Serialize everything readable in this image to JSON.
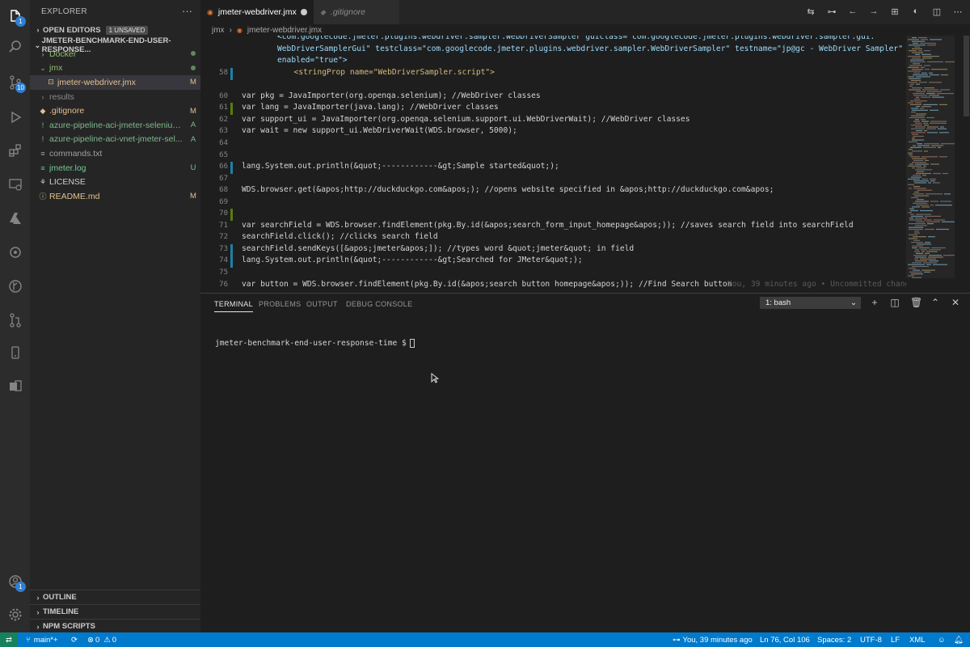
{
  "activity_bar": [
    {
      "name": "explorer-icon",
      "badge": "1"
    },
    {
      "name": "search-icon"
    },
    {
      "name": "source-control-icon",
      "badge": "10"
    },
    {
      "name": "run-debug-icon"
    },
    {
      "name": "extensions-icon"
    },
    {
      "name": "remote-explorer-icon"
    },
    {
      "name": "azure-icon"
    },
    {
      "name": "settings-sync-icon"
    },
    {
      "name": "git-graph-icon"
    },
    {
      "name": "pull-requests-icon"
    },
    {
      "name": "device-icon"
    },
    {
      "name": "test-icon"
    }
  ],
  "activity_bottom": {
    "account_badge": "1"
  },
  "sidebar": {
    "title": "EXPLORER",
    "more": "···",
    "open_editors": {
      "label": "OPEN EDITORS",
      "badge": "1 UNSAVED"
    },
    "folder": "JMETER-BENCHMARK-END-USER-RESPONSE...",
    "items": [
      {
        "label": "Docker",
        "icon": "›",
        "status": "",
        "dot": true,
        "color": "#8fbc6f",
        "indent": 1
      },
      {
        "label": "jmx",
        "icon": "⌄",
        "status": "",
        "dot": true,
        "color": "#8fbc6f",
        "indent": 1
      },
      {
        "label": "jmeter-webdriver.jmx",
        "icon": "⊡",
        "status": "M",
        "dot": false,
        "color": "#e2c08d",
        "indent": 2,
        "selected": true
      },
      {
        "label": "results",
        "icon": "›",
        "status": "",
        "dot": false,
        "color": "#8b8b8b",
        "indent": 1
      },
      {
        "label": ".gitignore",
        "icon": "◆",
        "status": "M",
        "dot": false,
        "color": "#e2c08d",
        "indent": 1
      },
      {
        "label": "azure-pipeline-aci-jmeter-selenium...",
        "icon": "!",
        "status": "A",
        "dot": false,
        "color": "#81b88b",
        "indent": 1
      },
      {
        "label": "azure-pipeline-aci-vnet-jmeter-sel...",
        "icon": "!",
        "status": "A",
        "dot": false,
        "color": "#81b88b",
        "indent": 1
      },
      {
        "label": "commands.txt",
        "icon": "≡",
        "status": "",
        "dot": false,
        "color": "#a0a0a0",
        "indent": 1
      },
      {
        "label": "jmeter.log",
        "icon": "≡",
        "status": "U",
        "dot": false,
        "color": "#73c991",
        "indent": 1
      },
      {
        "label": "LICENSE",
        "icon": "⚘",
        "status": "",
        "dot": false,
        "color": "#cccccc",
        "indent": 1
      },
      {
        "label": "README.md",
        "icon": "ⓘ",
        "status": "M",
        "dot": false,
        "color": "#e2c08d",
        "indent": 1
      }
    ],
    "bottom_sections": [
      "OUTLINE",
      "TIMELINE",
      "NPM SCRIPTS"
    ]
  },
  "tabs": [
    {
      "label": "jmeter-webdriver.jmx",
      "active": true
    },
    {
      "label": ".gitignore",
      "active": false
    }
  ],
  "breadcrumb": [
    "jmx",
    "›",
    "jmeter-webdriver.jmx"
  ],
  "code_lines": [
    {
      "num": "",
      "text": "<com.googlecode.jmeter.plugins.webdriver.sampler.WebDriverSampler guiclass=\"com.googlecode.jmeter.plugins.webdriver.sampler.gui.",
      "kind": "xml",
      "gutter": ""
    },
    {
      "num": "",
      "text": "WebDriverSamplerGui\" testclass=\"com.googlecode.jmeter.plugins.webdriver.sampler.WebDriverSampler\" testname=\"jp@gc - WebDriver Sampler\"",
      "kind": "xml",
      "gutter": ""
    },
    {
      "num": "",
      "text": "enabled=\"true\">",
      "kind": "xml",
      "gutter": ""
    },
    {
      "num": "58",
      "text": "  <stringProp name=\"WebDriverSampler.script\">",
      "kind": "xml",
      "gutter": "#1b81a8"
    },
    {
      "num": "",
      "text": "",
      "kind": "plain",
      "gutter": ""
    },
    {
      "num": "60",
      "text": "var pkg = JavaImporter(org.openqa.selenium); //WebDriver classes",
      "kind": "plain",
      "gutter": ""
    },
    {
      "num": "61",
      "text": "var lang = JavaImporter(java.lang); //WebDriver classes",
      "kind": "plain",
      "gutter": "#587c0c"
    },
    {
      "num": "62",
      "text": "var support_ui = JavaImporter(org.openqa.selenium.support.ui.WebDriverWait); //WebDriver classes",
      "kind": "plain",
      "gutter": ""
    },
    {
      "num": "63",
      "text": "var wait = new support_ui.WebDriverWait(WDS.browser, 5000);",
      "kind": "plain",
      "gutter": ""
    },
    {
      "num": "64",
      "text": "",
      "kind": "plain",
      "gutter": ""
    },
    {
      "num": "65",
      "text": "",
      "kind": "plain",
      "gutter": ""
    },
    {
      "num": "66",
      "text": "lang.System.out.println(&quot;------------&gt;Sample started&quot;);",
      "kind": "plain",
      "gutter": "#1b81a8"
    },
    {
      "num": "67",
      "text": "",
      "kind": "plain",
      "gutter": ""
    },
    {
      "num": "68",
      "text": "WDS.browser.get(&apos;http://duckduckgo.com&apos;); //opens website specified in &apos;http://duckduckgo.com&apos;",
      "kind": "plain",
      "gutter": ""
    },
    {
      "num": "69",
      "text": "",
      "kind": "plain",
      "gutter": ""
    },
    {
      "num": "70",
      "text": "",
      "kind": "plain",
      "gutter": "#587c0c"
    },
    {
      "num": "71",
      "text": "var searchField = WDS.browser.findElement(pkg.By.id(&apos;search_form_input_homepage&apos;)); //saves search field into searchField",
      "kind": "plain",
      "gutter": ""
    },
    {
      "num": "72",
      "text": "searchField.click(); //clicks search field",
      "kind": "plain",
      "gutter": ""
    },
    {
      "num": "73",
      "text": "searchField.sendKeys([&apos;jmeter&apos;]); //types word &quot;jmeter&quot; in field",
      "kind": "plain",
      "gutter": "#1b81a8"
    },
    {
      "num": "74",
      "text": "lang.System.out.println(&quot;------------&gt;Searched for JMeter&quot;);",
      "kind": "plain",
      "gutter": "#1b81a8"
    },
    {
      "num": "75",
      "text": "",
      "kind": "plain",
      "gutter": ""
    },
    {
      "num": "76",
      "text": "var button = WDS.browser.findElement(pkg.By.id(&apos;search_button_homepage&apos;)); //Find Search button",
      "kind": "plain",
      "gutter": ""
    }
  ],
  "blame_annotation": "You, 39 minutes ago • Uncommitted chang",
  "panel": {
    "tabs": [
      "TERMINAL",
      "PROBLEMS",
      "OUTPUT",
      "DEBUG CONSOLE"
    ],
    "terminal_select": "1: bash",
    "prompt": "jmeter-benchmark-end-user-response-time $"
  },
  "status_bar": {
    "branch": "main*+",
    "errors": "0",
    "warnings": "0",
    "blame": "You, 39 minutes ago",
    "position": "Ln 76, Col 106",
    "spaces": "Spaces: 2",
    "encoding": "UTF-8",
    "eol": "LF",
    "language": "XML"
  },
  "colors": {
    "accent": "#007acc",
    "activity_bg": "#2c2c2c",
    "sidebar_bg": "#252526",
    "editor_bg": "#1e1e1e"
  }
}
